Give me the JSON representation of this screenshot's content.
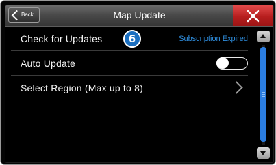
{
  "header": {
    "back_label": "Back",
    "title": "Map Update"
  },
  "rows": [
    {
      "label": "Check for Updates",
      "badge": "6",
      "status": "Subscription Expired"
    },
    {
      "label": "Auto Update",
      "toggle_on": false
    },
    {
      "label": "Select Region (Max up to 8)"
    }
  ],
  "colors": {
    "accent": "#2f8fe0",
    "close": "#c62828",
    "badge": "#1b6fc0"
  },
  "icons": {
    "back": "chevron-left-icon",
    "close": "close-icon",
    "row_arrow": "chevron-right-icon",
    "scroll_up": "triangle-up-icon",
    "scroll_down": "triangle-down-icon"
  }
}
